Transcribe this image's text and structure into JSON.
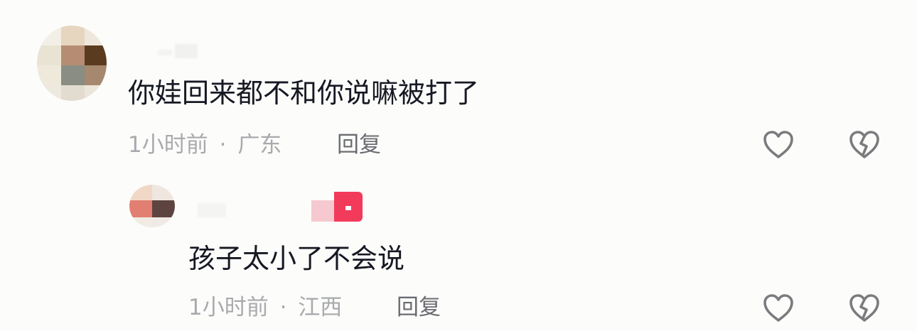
{
  "comments": [
    {
      "text": "你娃回来都不和你说嘛被打了",
      "time": "1小时前",
      "separator": "·",
      "location": "广东",
      "reply_label": "回复"
    },
    {
      "text": "孩子太小了不会说",
      "time": "1小时前",
      "separator": "·",
      "location": "江西",
      "reply_label": "回复"
    }
  ],
  "icons": {
    "like": "heart-outline-icon",
    "dislike": "broken-heart-icon"
  },
  "colors": {
    "background": "#fcfcfa",
    "text": "#161823",
    "meta": "#a9aaae",
    "reply": "#6b6c72",
    "icon": "#7b7b7f",
    "badge": "#f23a5a"
  }
}
